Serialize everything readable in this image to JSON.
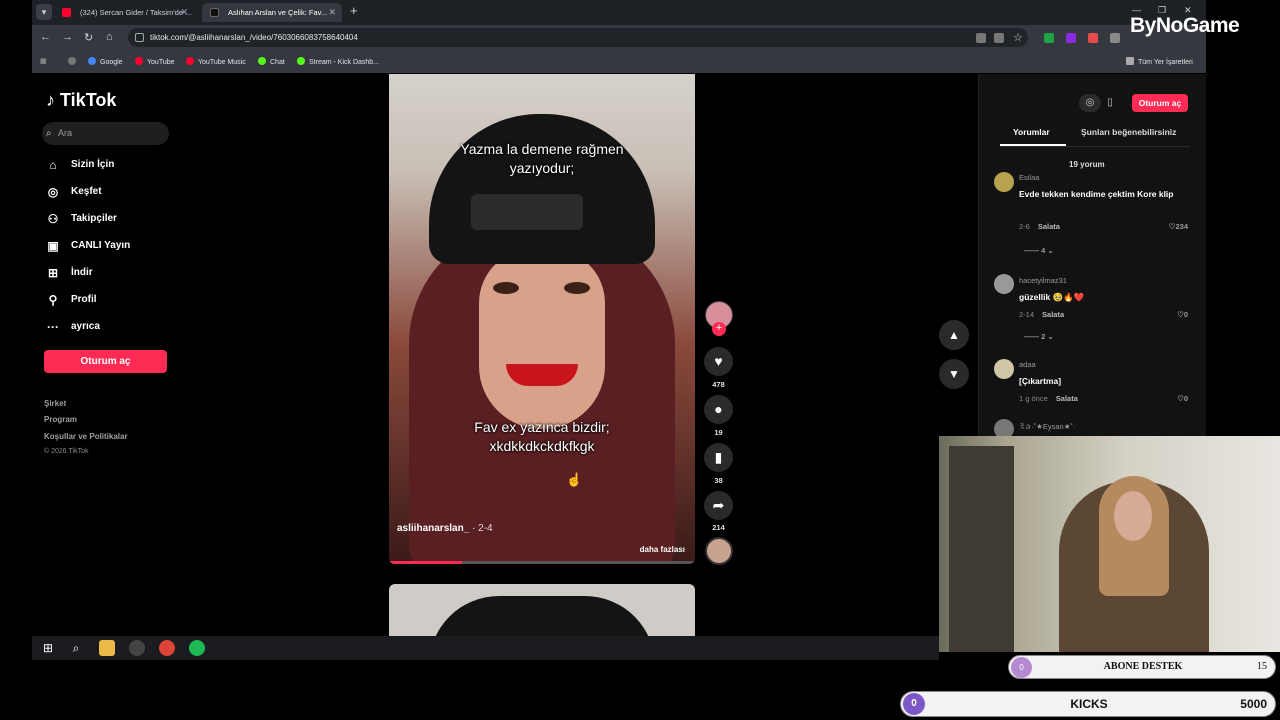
{
  "browser": {
    "tabs": [
      {
        "title": "(324) Sercan Gider / Taksim'de ..."
      },
      {
        "title": "Aslıhan Arslan ve Çelik: Fav..."
      }
    ],
    "url": "tiktok.com/@asliihanarslan_/video/7603066083758640404",
    "bookmarks": [
      "Google",
      "YouTube",
      "YouTube Music",
      "Chat",
      "Stream - Kick Dashb..."
    ],
    "all_bookmarks": "Tüm Yer İşaretleri"
  },
  "overlay_logo": "ByNoGame",
  "tiktok": {
    "logo": "TikTok",
    "search_placeholder": "Ara",
    "nav": [
      "Sizin İçin",
      "Keşfet",
      "Takipçiler",
      "CANLI Yayın",
      "İndir",
      "Profil",
      "ayrıca"
    ],
    "login_button": "Oturum aç",
    "footer_links": [
      "Şirket",
      "Program",
      "Koşullar ve Politikalar"
    ],
    "copyright": "© 2026 TikTok"
  },
  "video": {
    "caption_top": [
      "Yazma la demene rağmen",
      "yazıyodur;"
    ],
    "caption_bottom": [
      "Fav ex yazınca bizdir;",
      "xkdkkdkckdkfkgk"
    ],
    "author": "asliihanarslan_",
    "date": " · 2-4",
    "more": "daha fazlası",
    "progress": 0.24
  },
  "actions": {
    "likes": "478",
    "comments": "19",
    "saves": "38",
    "shares": "214"
  },
  "panel": {
    "login_button": "Oturum aç",
    "tab_comments": "Yorumlar",
    "tab_suggest": "Şunları beğenebilirsiniz",
    "comment_count": "19 yorum",
    "comments": [
      {
        "user": "Esilaa",
        "text": "Evde tekken kendime çektim Kore klip",
        "date": "2-6",
        "category": "Salata",
        "likes": "234",
        "replies": "4"
      },
      {
        "user": "hacetyilmaz31",
        "text": "güzellik 🥹🔥❤️",
        "date": "2-14",
        "category": "Salata",
        "likes": "0",
        "replies": "2"
      },
      {
        "user": "adaa",
        "text": "[Çıkartma]",
        "date": "1 g önce",
        "category": "Salata",
        "likes": "0"
      },
      {
        "user": "ꉂ✰·˚★Eysan★˚·"
      }
    ]
  },
  "goals": {
    "sub_label": "ABONE DESTEK",
    "sub_current": "0",
    "sub_target": "15",
    "kicks_label": "KICKS",
    "kicks_current": "0",
    "kicks_target": "5000"
  },
  "colors": {
    "accent": "#fe2c55",
    "background": "#000000"
  }
}
